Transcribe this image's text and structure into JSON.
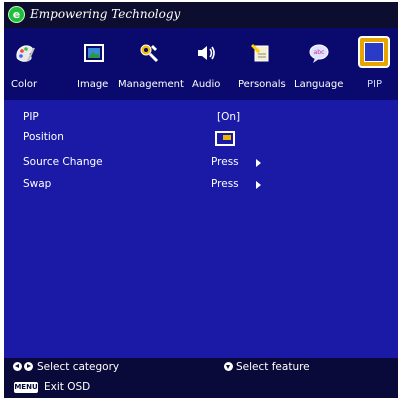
{
  "header": {
    "brand_text": "Empowering Technology",
    "logo_letter": "e"
  },
  "tabs": [
    {
      "label": "Color",
      "icon": "palette-icon"
    },
    {
      "label": "Image",
      "icon": "image-icon"
    },
    {
      "label": "Management",
      "icon": "management-icon"
    },
    {
      "label": "Audio",
      "icon": "speaker-icon"
    },
    {
      "label": "Personals",
      "icon": "personals-icon"
    },
    {
      "label": "Language",
      "icon": "language-icon"
    },
    {
      "label": "PIP",
      "icon": "pip-icon"
    }
  ],
  "active_tab": "PIP",
  "menu": {
    "pip_label": "PIP",
    "pip_value": "[On]",
    "position_label": "Position",
    "source_change_label": "Source  Change",
    "source_change_value": "Press",
    "swap_label": "Swap",
    "swap_value": "Press"
  },
  "footer": {
    "select_category": "Select  category",
    "select_feature": "Select  feature",
    "menu_key": "MENU",
    "exit_osd": "Exit  OSD"
  },
  "colors": {
    "background": "#1a1aa6",
    "tab_bar": "#0a0a6e",
    "title_bar": "#0d0d30",
    "footer": "#0a0a3a",
    "active_tab_frame": "#e6a500",
    "logo": "#1fbf3b"
  }
}
